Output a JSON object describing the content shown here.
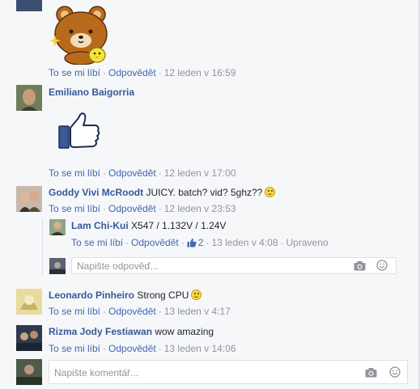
{
  "comments": [
    {
      "name": "",
      "text": "",
      "actions": {
        "like": "To se mi líbí",
        "reply": "Odpovědět",
        "time": "12 leden v 16:59"
      },
      "sticker": "bear-sticker"
    },
    {
      "name": "Emiliano Baigorria",
      "text": "",
      "actions": {
        "like": "To se mi líbí",
        "reply": "Odpovědět",
        "time": "12 leden v 17:00"
      },
      "sticker": "thumbs-up-sticker"
    },
    {
      "name": "Goddy Vivi McRoodt",
      "text": "JUICY. batch? vid? 5ghz??",
      "actions": {
        "like": "To se mi líbí",
        "reply": "Odpovědět",
        "time": "12 leden v 23:53"
      },
      "emoji": "smile-emoji"
    },
    {
      "name": "Leonardo Pinheiro",
      "text": "Strong CPU",
      "actions": {
        "like": "To se mi líbí",
        "reply": "Odpovědět",
        "time": "13 leden v 4:17"
      },
      "emoji": "smile-emoji"
    },
    {
      "name": "Rizma Jody Festiawan",
      "text": "wow amazing",
      "actions": {
        "like": "To se mi líbí",
        "reply": "Odpovědět",
        "time": "13 leden v 14:06"
      }
    }
  ],
  "reply": {
    "name": "Lam Chi-Kui",
    "text": "X547 / 1.132V / 1.24V",
    "actions": {
      "like": "To se mi líbí",
      "reply": "Odpovědět",
      "likes": "2",
      "time": "13 leden v 4:08",
      "edited": "Upraveno"
    }
  },
  "reply_input": {
    "placeholder": "Napište odpověď..."
  },
  "comment_input": {
    "placeholder": "Napište komentář..."
  },
  "colors": {
    "link": "#4267b2",
    "name": "#365899",
    "meta": "#90949c",
    "background": "#f6f7f9"
  },
  "icons": [
    "camera-icon",
    "emoji-icon",
    "like-icon"
  ]
}
